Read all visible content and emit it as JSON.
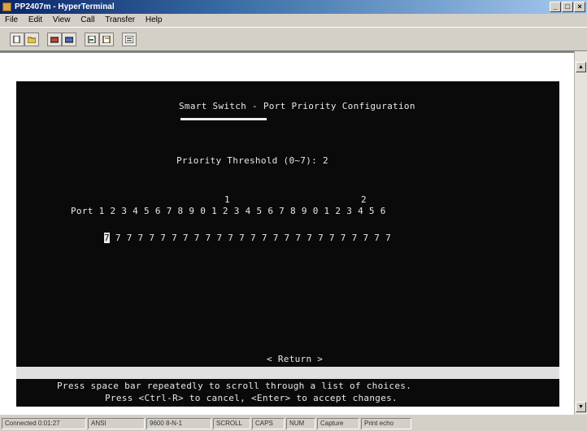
{
  "window": {
    "title": "PP2407m - HyperTerminal",
    "minimize": "_",
    "maximize": "□",
    "close": "×"
  },
  "menu": [
    "File",
    "Edit",
    "View",
    "Call",
    "Transfer",
    "Help"
  ],
  "toolbar": {
    "buttons": [
      "new-icon",
      "open-icon",
      "connect-icon",
      "disconnect-icon",
      "send-icon",
      "receive-icon",
      "properties-icon"
    ]
  },
  "terminal": {
    "title": "Smart Switch - Port Priority Configuration",
    "threshold_label": "Priority Threshold (0~7): 2",
    "tens_digit_1": "1",
    "tens_digit_2": "2",
    "ports_label": "Port",
    "ports_digits": "1 2 3 4 5 6 7 8 9 0 1 2 3 4 5 6 7 8 9 0 1 2 3 4 5 6",
    "selected_value": "7",
    "values": " 7 7 7 7 7 7 7 7 7 7 7 7 7 7 7 7 7 7 7 7 7 7 7 7 7",
    "return_label": "< Return >",
    "help_line_1": "Press space bar repeatedly to scroll through a list of choices.",
    "help_line_2": "Press <Ctrl-R> to cancel, <Enter> to accept changes."
  },
  "status": {
    "connected": "Connected 0:01:27",
    "emulation": "ANSI",
    "settings": "9600 8-N-1",
    "scroll": "SCROLL",
    "caps": "CAPS",
    "num": "NUM",
    "capture": "Capture",
    "echo": "Print echo"
  },
  "colors": {
    "terminal_bg": "#0a0a0a",
    "terminal_fg": "#e8e8e8",
    "title_gradient_start": "#0a246a"
  }
}
